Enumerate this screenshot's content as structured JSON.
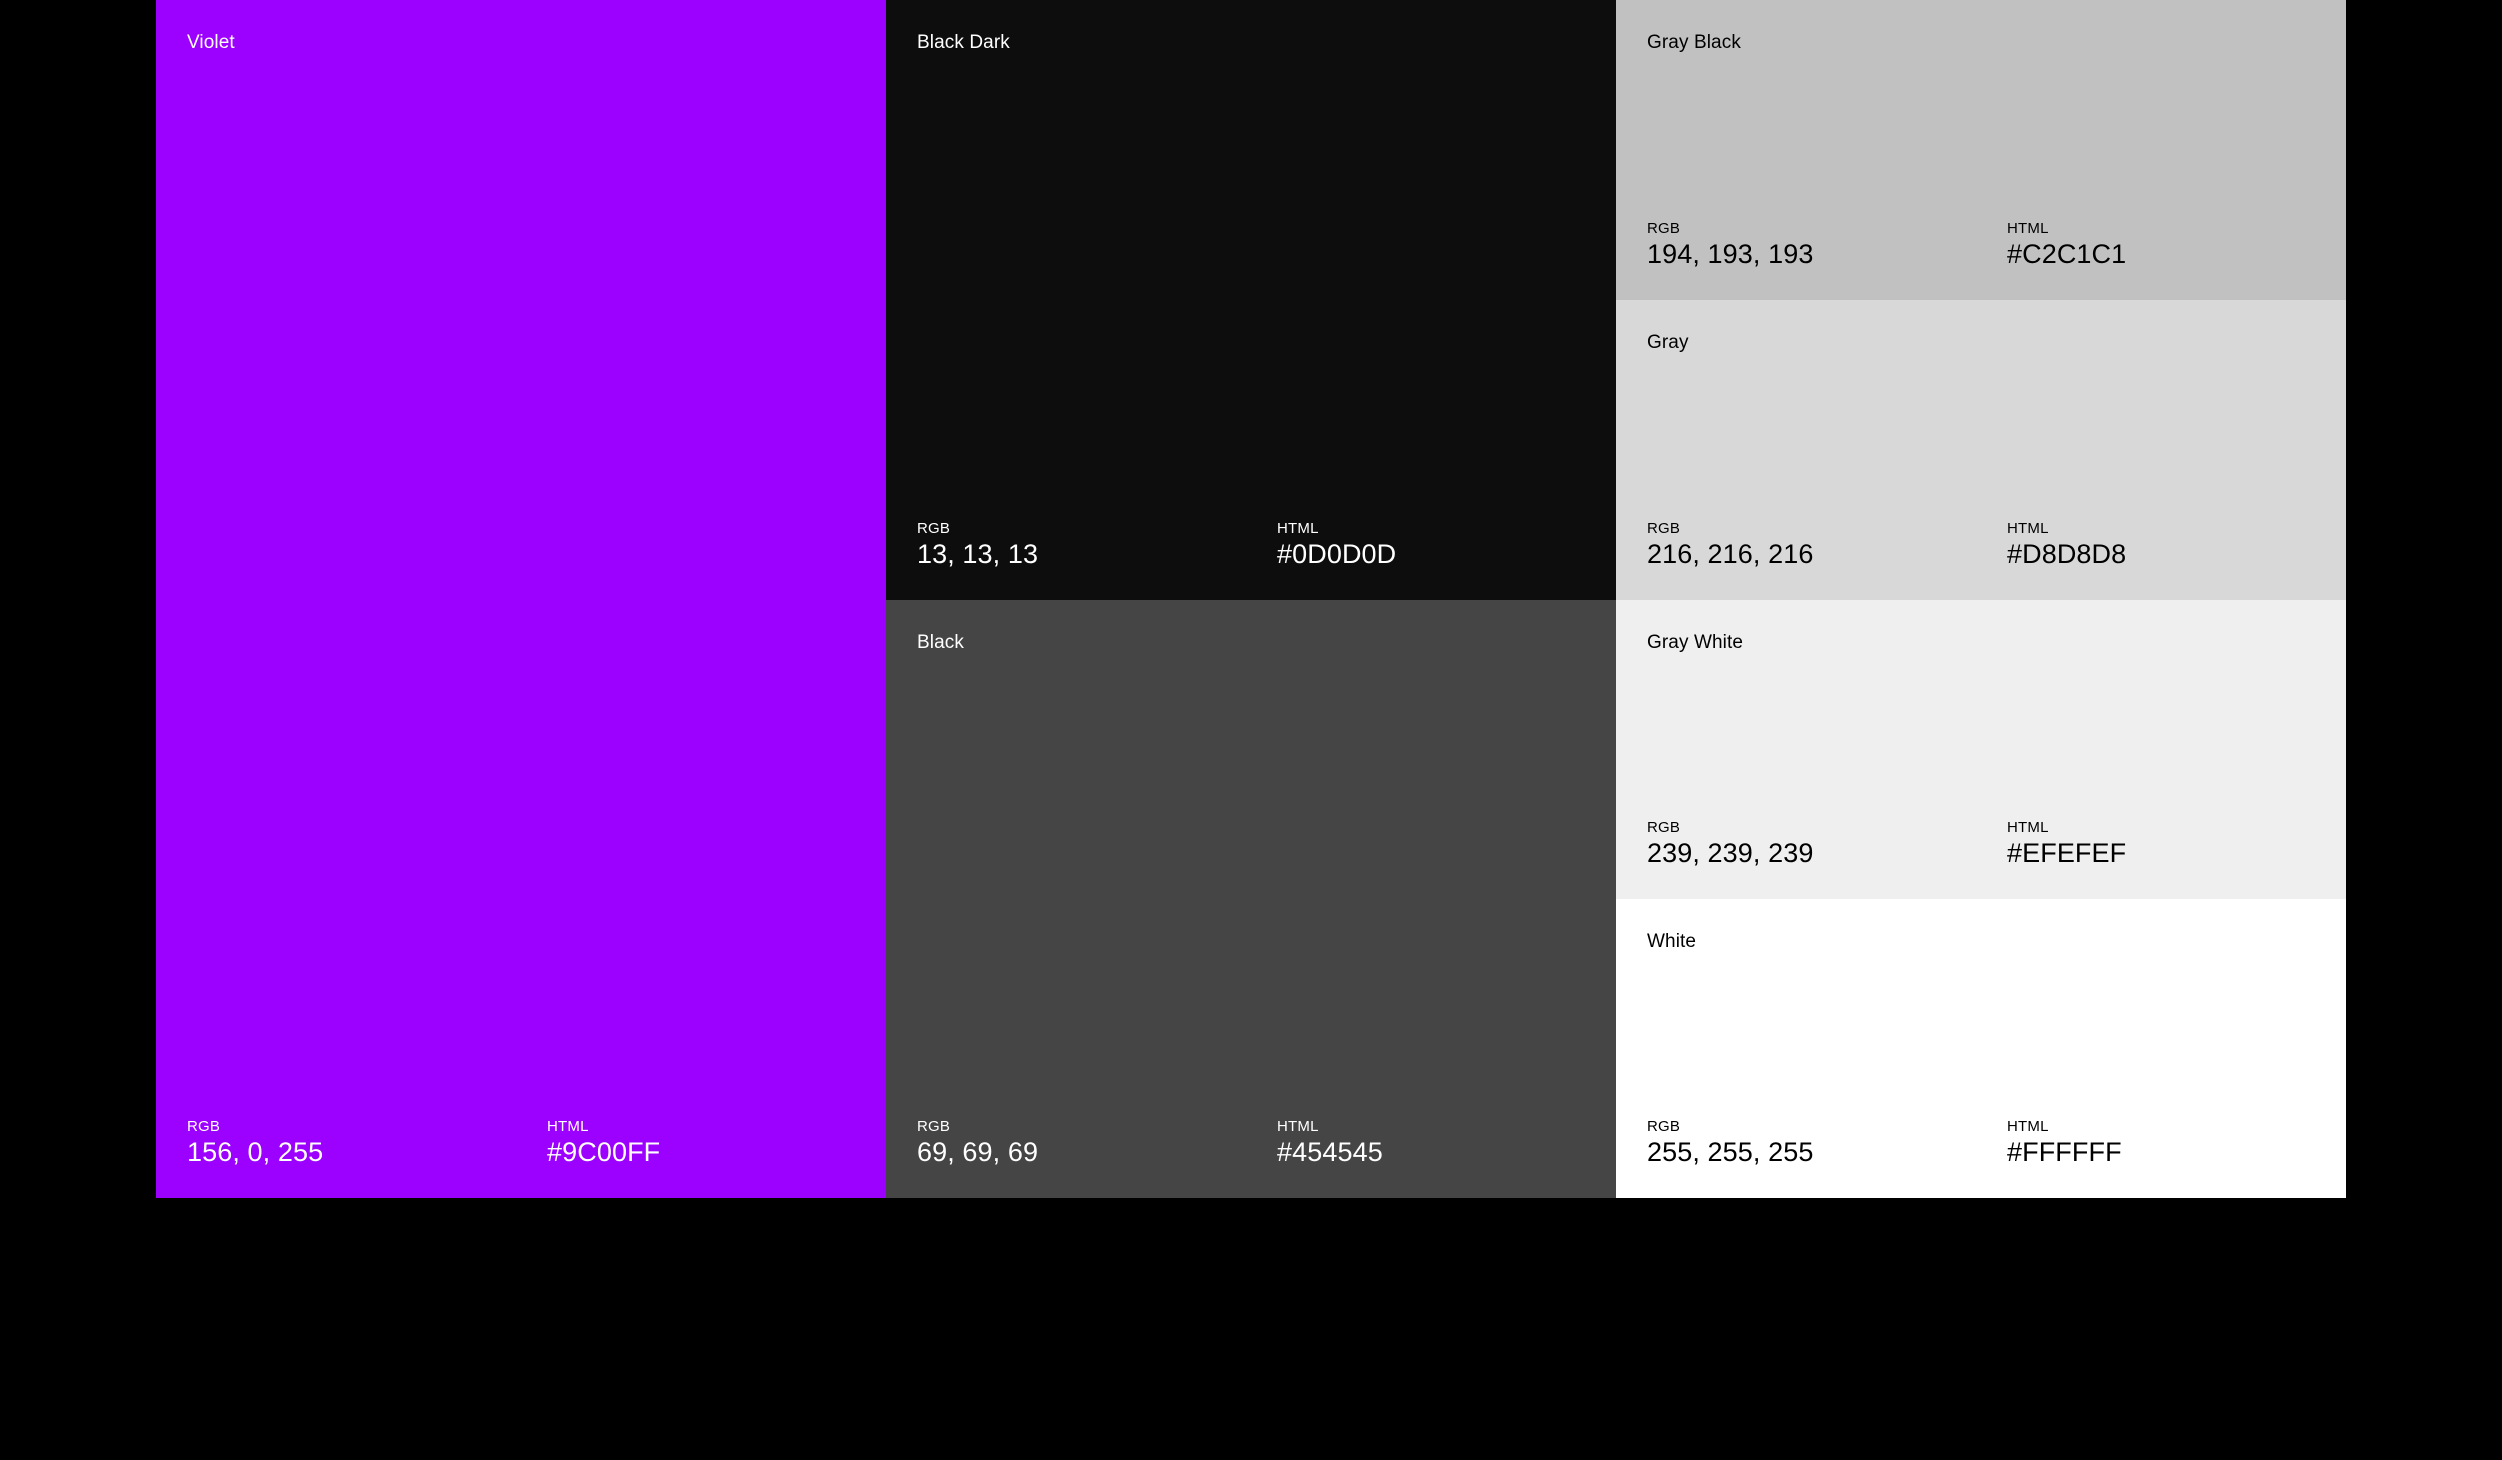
{
  "palette": {
    "swatches": [
      {
        "id": "violet",
        "name": "Violet",
        "rgb_label": "RGB",
        "rgb": "156, 0, 255",
        "html_label": "HTML",
        "html": "#9C00FF",
        "color": "#9C00FF",
        "text_color": "#FFFFFF"
      },
      {
        "id": "black-dark",
        "name": "Black Dark",
        "rgb_label": "RGB",
        "rgb": "13, 13, 13",
        "html_label": "HTML",
        "html": "#0D0D0D",
        "color": "#0D0D0D",
        "text_color": "#FFFFFF"
      },
      {
        "id": "black",
        "name": "Black",
        "rgb_label": "RGB",
        "rgb": "69, 69, 69",
        "html_label": "HTML",
        "html": "#454545",
        "color": "#454545",
        "text_color": "#FFFFFF"
      },
      {
        "id": "gray-black",
        "name": "Gray Black",
        "rgb_label": "RGB",
        "rgb": "194, 193, 193",
        "html_label": "HTML",
        "html": "#C2C1C1",
        "color": "#C2C1C1",
        "text_color": "#000000"
      },
      {
        "id": "gray",
        "name": "Gray",
        "rgb_label": "RGB",
        "rgb": "216, 216, 216",
        "html_label": "HTML",
        "html": "#D8D8D8",
        "color": "#D8D8D8",
        "text_color": "#000000"
      },
      {
        "id": "gray-white",
        "name": "Gray White",
        "rgb_label": "RGB",
        "rgb": "239, 239, 239",
        "html_label": "HTML",
        "html": "#EFEFEF",
        "color": "#EFEFEF",
        "text_color": "#000000"
      },
      {
        "id": "white",
        "name": "White",
        "rgb_label": "RGB",
        "rgb": "255, 255, 255",
        "html_label": "HTML",
        "html": "#FFFFFF",
        "color": "#FFFFFF",
        "text_color": "#000000"
      }
    ]
  },
  "colors": {
    "page_background": "#000000"
  }
}
